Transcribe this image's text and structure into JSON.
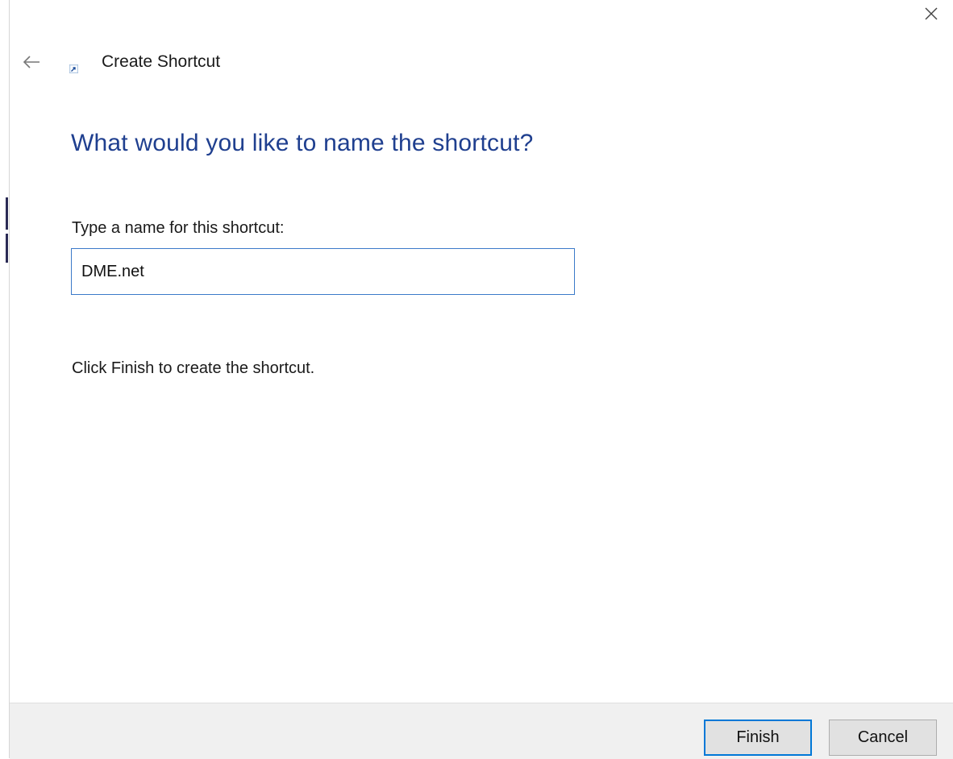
{
  "window": {
    "title": "Create Shortcut"
  },
  "wizard": {
    "heading": "What would you like to name the shortcut?",
    "field_label": "Type a name for this shortcut:",
    "name_value": "DME.net",
    "hint": "Click Finish to create the shortcut."
  },
  "footer": {
    "finish_label": "Finish",
    "cancel_label": "Cancel"
  },
  "icons": {
    "close": "close-icon",
    "back": "back-arrow-icon",
    "app": "shortcut-icon"
  },
  "colors": {
    "heading": "#1f3f8f",
    "input_border": "#3b7ac9",
    "default_button_border": "#0078d7",
    "footer_bg": "#f0f0f0"
  }
}
